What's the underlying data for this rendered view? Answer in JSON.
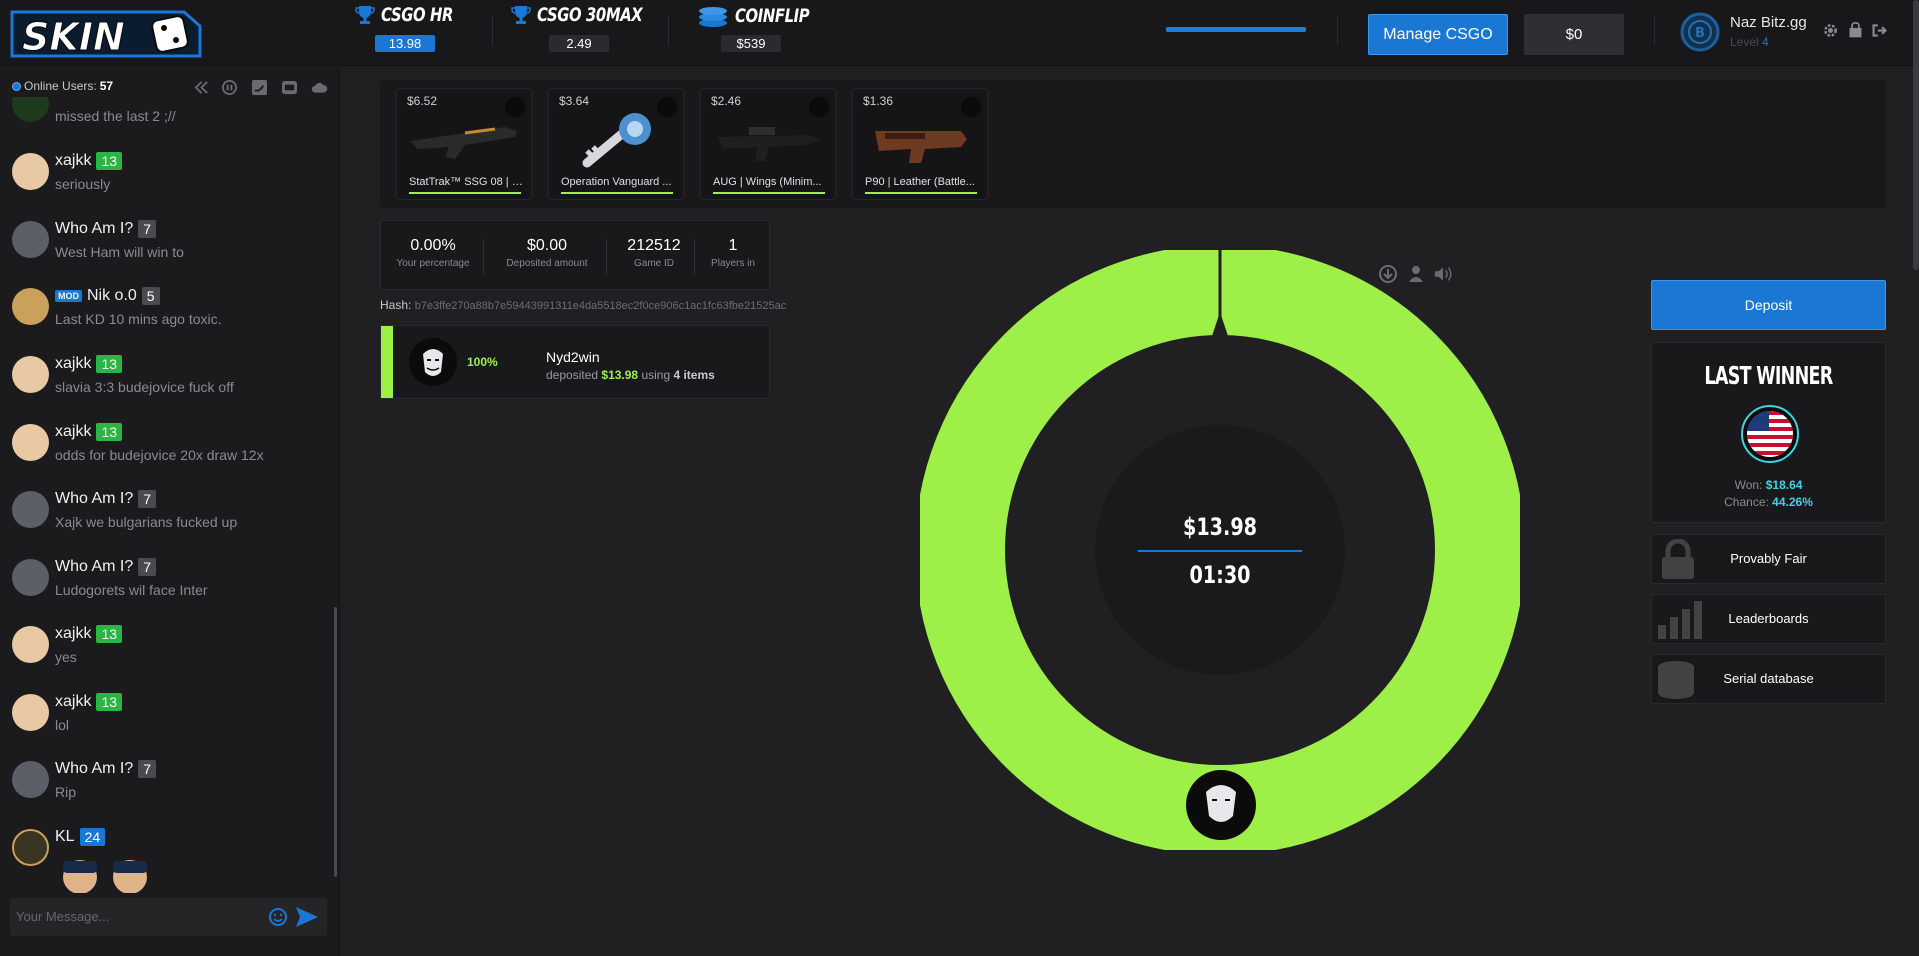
{
  "logo": {
    "text": "SKIN"
  },
  "games": [
    {
      "title": "CSGO HR",
      "value": "13.98"
    },
    {
      "title": "CSGO 30MAX",
      "value": "2.49"
    },
    {
      "title": "COINFLIP",
      "value": "$539"
    }
  ],
  "header": {
    "progress": 1.0,
    "manage_label": "Manage CSGO",
    "balance": "$0",
    "username": "Naz Bitz.gg",
    "level_label": "Level",
    "level_value": "4"
  },
  "chat": {
    "online_label": "Online Users:",
    "online_count": "57",
    "partial_message": {
      "text": "missed the last 2 ;//"
    },
    "messages": [
      {
        "user": "xajkk",
        "level": "13",
        "text": "seriously"
      },
      {
        "user": "Who Am I?",
        "level": "7",
        "text": "West Ham will win to"
      },
      {
        "user": "Nik o.0",
        "level": "5",
        "text": "Last KD 10 mins ago toxic.",
        "badge": "MOD"
      },
      {
        "user": "xajkk",
        "level": "13",
        "text": "slavia 3:3 budejovice fuck off"
      },
      {
        "user": "xajkk",
        "level": "13",
        "text": "odds for budejovice 20x draw 12x"
      },
      {
        "user": "Who Am I?",
        "level": "7",
        "text": "Xajk we bulgarians fucked up"
      },
      {
        "user": "Who Am I?",
        "level": "7",
        "text": "Ludogorets wil face Inter"
      },
      {
        "user": "xajkk",
        "level": "13",
        "text": "yes"
      },
      {
        "user": "xajkk",
        "level": "13",
        "text": "lol"
      },
      {
        "user": "Who Am I?",
        "level": "7",
        "text": "Rip"
      },
      {
        "user": "KL",
        "level": "24",
        "text": ""
      }
    ],
    "input_placeholder": "Your Message..."
  },
  "items": [
    {
      "price": "$6.52",
      "name": "StatTrak™ SSG 08 | D..."
    },
    {
      "price": "$3.64",
      "name": "Operation Vanguard ..."
    },
    {
      "price": "$2.46",
      "name": "AUG | Wings (Minim..."
    },
    {
      "price": "$1.36",
      "name": "P90 | Leather (Battle..."
    }
  ],
  "stats": [
    {
      "value": "0.00%",
      "label": "Your percentage"
    },
    {
      "value": "$0.00",
      "label": "Deposited amount"
    },
    {
      "value": "212512",
      "label": "Game ID"
    },
    {
      "value": "1",
      "label": "Players in"
    }
  ],
  "hash": {
    "label": "Hash:",
    "value": "b7e3ffe270a88b7e59443991311e4da5518ec2f0ce906c1ac1fc63fbe21525ac"
  },
  "player": {
    "percent": "100%",
    "name": "Nyd2win",
    "deposited_word": "deposited",
    "amount": "$13.98",
    "using_word": "using",
    "items": "4 items"
  },
  "wheel": {
    "pot": "$13.98",
    "timer": "01:30",
    "color": "#9ef048"
  },
  "right": {
    "deposit_label": "Deposit",
    "last_winner_title": "LAST WINNER",
    "won_label": "Won:",
    "won_value": "$18.64",
    "chance_label": "Chance:",
    "chance_value": "44.26%",
    "buttons": [
      "Provably Fair",
      "Leaderboards",
      "Serial database"
    ]
  },
  "colors": {
    "accent_blue": "#1a78d4",
    "accent_green": "#9ef048",
    "level_green": "#2ab544",
    "cyan": "#3fd2e6",
    "background": "#202022"
  }
}
